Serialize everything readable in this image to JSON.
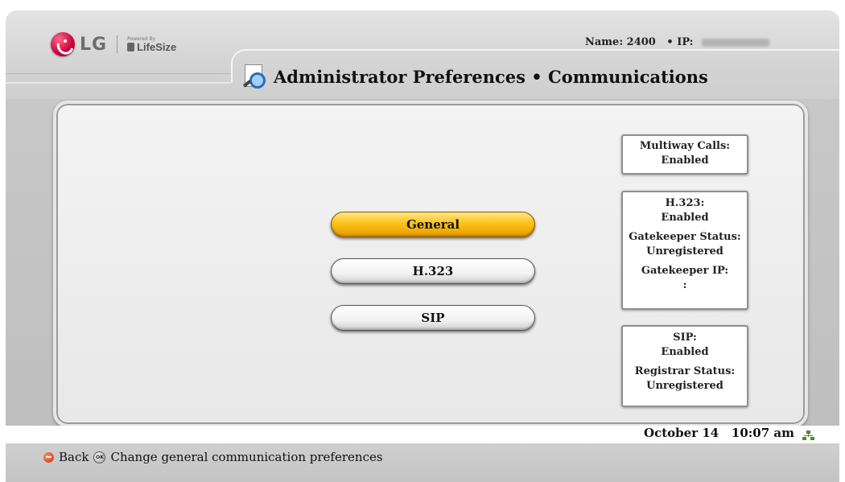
{
  "header": {
    "logo_text": "LG",
    "powered_by": "Powered By",
    "lifesize": "LifeSize",
    "name_label": "Name: 2400",
    "ip_label": "• IP:",
    "title": "Administrator Preferences • Communications"
  },
  "menu": {
    "items": [
      {
        "label": "General",
        "selected": true
      },
      {
        "label": "H.323",
        "selected": false
      },
      {
        "label": "SIP",
        "selected": false
      }
    ]
  },
  "status": {
    "multiway": {
      "label": "Multiway Calls:",
      "value": "Enabled"
    },
    "h323": {
      "label": "H.323:",
      "value": "Enabled",
      "gk_status_label": "Gatekeeper Status:",
      "gk_status_value": "Unregistered",
      "gk_ip_label": "Gatekeeper IP:",
      "gk_ip_value": ":"
    },
    "sip": {
      "label": "SIP:",
      "value": "Enabled",
      "registrar_label": "Registrar Status:",
      "registrar_value": "Unregistered"
    }
  },
  "footer": {
    "date": "October 14",
    "time": "10:07 am",
    "back_label": "Back",
    "hint": "Change general communication preferences",
    "ok_icon_text": "OK"
  },
  "colors": {
    "selected_button": "#fcc316",
    "frame": "#c9c9c9"
  },
  "icons": [
    "lg-logo-icon",
    "lifesize-logo-icon",
    "admin-preferences-icon",
    "network-status-icon",
    "back-button-icon",
    "ok-button-icon"
  ]
}
